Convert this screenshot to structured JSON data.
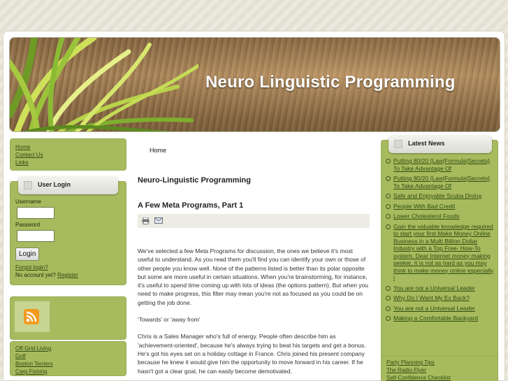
{
  "site": {
    "title": "Neuro Linguistic Programming"
  },
  "main_menu": {
    "items": [
      "Home",
      "Contact Us",
      "Links"
    ]
  },
  "login": {
    "title": "User Login",
    "username_label": "Username",
    "password_label": "Password",
    "button": "Login",
    "forgot": "Forgot login?",
    "no_account": "No account yet?",
    "register": "Register"
  },
  "other_menu": {
    "items": [
      "Off-Grid Living",
      "Golf",
      "Boston Terriers",
      "Carp Fishing"
    ]
  },
  "breadcrumb": "Home",
  "content": {
    "section_title": "Neuro-Linguistic Programming",
    "article_title": "A Few Meta Programs, Part 1",
    "paragraphs": [
      "We've selected a few Meta Programs for discussion, the ones we believe it's most useful to understand. As you read them you'll find you can identify your own or those of other people you know well. None of the patterns listed is better than its polar opposite but some are more useful in certain situations. When you're brainstorming, for instance, it's useful to spend time coming up with lots of ideas (the options pattern). But when you need to make progress, this filter may mean you're not as focused as you could be on getting the job done.",
      "'Towards' or 'away from'",
      "Chris is a Sales Manager who's full of energy. People often describe him as 'achievement-oriented', because he's always trying to beat his targets and get a bonus. He's got his eyes set on a holiday cottage in France. Chris joined his present company because he knew it would give him the opportunity to move forward in his career. If he hasn't got a clear goal, he can easily become demotivated."
    ]
  },
  "news": {
    "title": "Latest News",
    "items": [
      "Putting 80/20 {Law|Formula|Secrets} To Take Advantage Of",
      "Putting 80/20 {Law|Formula|Secrets} To Take Advantage Of",
      "Safe and Enjoyable Scuba Diving",
      "People With Bad Credit",
      "Lower Cholesterol Foods",
      "Gain the valuable knowledge required to start your first Make Money Online Business in a Multi Billion Dollar Industry with a Top Free- How-To system. Dear Internet money making seeker, It is not as hard as you may think to make money online especially i",
      "You are not a Universal Leader",
      "Why Do I Want My Ex Back?",
      "You are not a Universal Leader",
      "Making a Comfortable Backyard"
    ]
  },
  "right_links": {
    "items": [
      "Party Planning Tips",
      "The Radio Flyer",
      "Self-Confidence Checklist"
    ]
  }
}
